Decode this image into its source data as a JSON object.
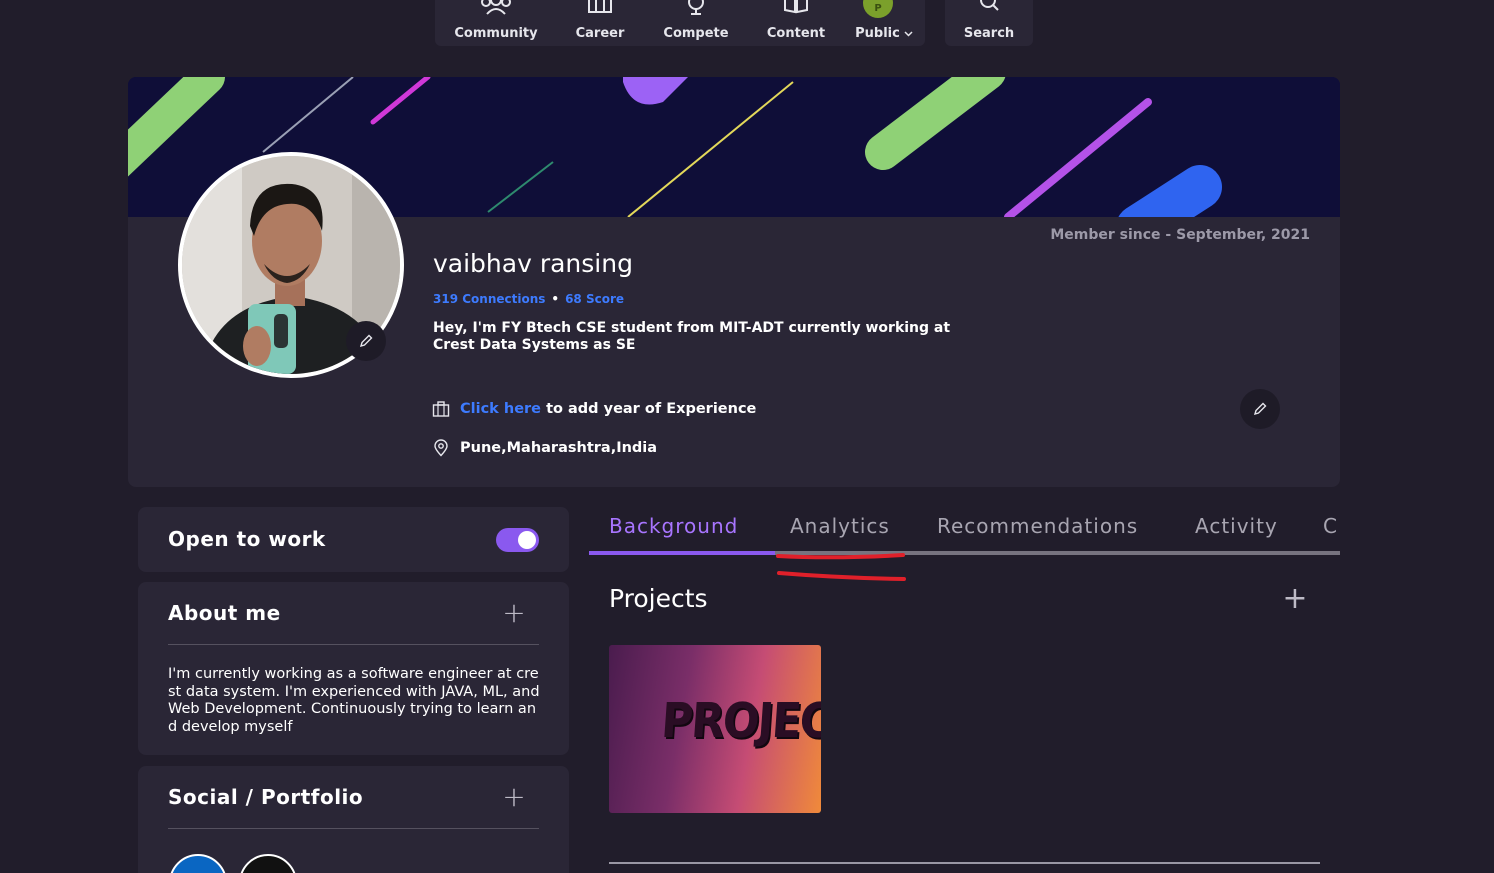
{
  "nav": {
    "items": [
      {
        "label": "Community",
        "icon": "community-icon"
      },
      {
        "label": "Career",
        "icon": "career-icon"
      },
      {
        "label": "Compete",
        "icon": "trophy-icon"
      },
      {
        "label": "Content",
        "icon": "book-icon"
      },
      {
        "label": "Public",
        "icon": "avatar-icon"
      }
    ],
    "public_avatar_letter": "P",
    "search_label": "Search"
  },
  "profile": {
    "member_since": "Member since - September, 2021",
    "name": "vaibhav ransing",
    "connections": "319 Connections",
    "score": "68 Score",
    "separator": "•",
    "headline": "Hey, I'm FY Btech CSE student from MIT-ADT currently working at Crest Data Systems as SE",
    "experience_link": "Click here",
    "experience_text": "to add year of Experience",
    "location": "Pune,Maharashtra,India"
  },
  "sidebar": {
    "open_to_work": {
      "label": "Open to work",
      "enabled": true
    },
    "about": {
      "title": "About me",
      "text": "I'm currently working as a software engineer at crest data system. I'm experienced with JAVA, ML, and Web Development. Continuously trying to learn and develop myself"
    },
    "social": {
      "title": "Social / Portfolio"
    }
  },
  "tabs": [
    {
      "label": "Background",
      "active": true
    },
    {
      "label": "Analytics",
      "active": false
    },
    {
      "label": "Recommendations",
      "active": false
    },
    {
      "label": "Activity",
      "active": false
    },
    {
      "label": "C",
      "active": false
    }
  ],
  "projects": {
    "title": "Projects",
    "thumbnail_text": "PROJECTS"
  },
  "colors": {
    "background": "#211d2b",
    "card": "#2a2636",
    "accent": "#8a59ef",
    "link": "#3d7bff",
    "annotation": "#e0202a"
  }
}
